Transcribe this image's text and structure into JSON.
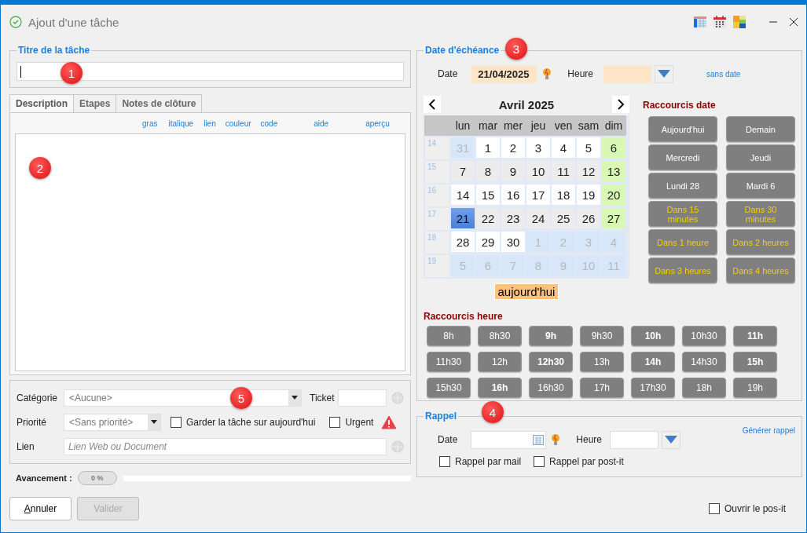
{
  "window": {
    "title": "Ajout d'une tâche"
  },
  "title_section": {
    "legend": "Titre de la tâche"
  },
  "tabs": [
    {
      "label": "Description",
      "selected": true
    },
    {
      "label": "Etapes",
      "selected": false
    },
    {
      "label": "Notes de clôture",
      "selected": false
    }
  ],
  "editor_toolbar": [
    "gras",
    "italique",
    "lien",
    "couleur",
    "code",
    "aide",
    "aperçu"
  ],
  "properties": {
    "category": {
      "label": "Catégorie",
      "value": "<Aucune>"
    },
    "ticket": {
      "label": "Ticket"
    },
    "priority": {
      "label": "Priorité",
      "value": "<Sans priorité>"
    },
    "keep_today": {
      "label": "Garder la tâche sur aujourd'hui",
      "checked": false
    },
    "urgent": {
      "label": "Urgent",
      "checked": false
    },
    "link": {
      "label": "Lien",
      "placeholder": "Lien Web ou Document"
    }
  },
  "progress": {
    "label": "Avancement :",
    "reading": "0 %",
    "level": 0
  },
  "due": {
    "legend": "Date d'échéance",
    "date_label": "Date",
    "date_value": "21/04/2025",
    "time_label": "Heure",
    "no_date_link": "sans date"
  },
  "calendar": {
    "month": "Avril 2025",
    "weekdays": [
      "lun",
      "mar",
      "mer",
      "jeu",
      "ven",
      "sam",
      "dim"
    ],
    "weeks": [
      {
        "number": "14",
        "days": [
          {
            "day": "31",
            "kind": "other",
            "selected": false
          },
          {
            "day": "1",
            "kind": "normal",
            "selected": false
          },
          {
            "day": "2",
            "kind": "normal",
            "selected": false
          },
          {
            "day": "3",
            "kind": "normal",
            "selected": false
          },
          {
            "day": "4",
            "kind": "normal",
            "selected": false
          },
          {
            "day": "5",
            "kind": "normal",
            "selected": false
          },
          {
            "day": "6",
            "kind": "sunday",
            "selected": false
          }
        ]
      },
      {
        "number": "15",
        "days": [
          {
            "day": "7",
            "kind": "normal",
            "selected": false
          },
          {
            "day": "8",
            "kind": "normal",
            "selected": false
          },
          {
            "day": "9",
            "kind": "normal",
            "selected": false
          },
          {
            "day": "10",
            "kind": "normal",
            "selected": false
          },
          {
            "day": "11",
            "kind": "normal",
            "selected": false
          },
          {
            "day": "12",
            "kind": "normal",
            "selected": false
          },
          {
            "day": "13",
            "kind": "sunday",
            "selected": false
          }
        ]
      },
      {
        "number": "16",
        "days": [
          {
            "day": "14",
            "kind": "normal",
            "selected": false
          },
          {
            "day": "15",
            "kind": "normal",
            "selected": false
          },
          {
            "day": "16",
            "kind": "normal",
            "selected": false
          },
          {
            "day": "17",
            "kind": "normal",
            "selected": false
          },
          {
            "day": "18",
            "kind": "normal",
            "selected": false
          },
          {
            "day": "19",
            "kind": "normal",
            "selected": false
          },
          {
            "day": "20",
            "kind": "sunday",
            "selected": false
          }
        ]
      },
      {
        "number": "17",
        "days": [
          {
            "day": "21",
            "kind": "normal",
            "selected": true
          },
          {
            "day": "22",
            "kind": "normal",
            "selected": false
          },
          {
            "day": "23",
            "kind": "normal",
            "selected": false
          },
          {
            "day": "24",
            "kind": "normal",
            "selected": false
          },
          {
            "day": "25",
            "kind": "normal",
            "selected": false
          },
          {
            "day": "26",
            "kind": "normal",
            "selected": false
          },
          {
            "day": "27",
            "kind": "sunday",
            "selected": false
          }
        ]
      },
      {
        "number": "18",
        "days": [
          {
            "day": "28",
            "kind": "normal",
            "selected": false
          },
          {
            "day": "29",
            "kind": "normal",
            "selected": false
          },
          {
            "day": "30",
            "kind": "normal",
            "selected": false
          },
          {
            "day": "1",
            "kind": "other",
            "selected": false
          },
          {
            "day": "2",
            "kind": "other",
            "selected": false
          },
          {
            "day": "3",
            "kind": "other",
            "selected": false
          },
          {
            "day": "4",
            "kind": "other",
            "selected": false
          }
        ]
      },
      {
        "number": "19",
        "days": [
          {
            "day": "5",
            "kind": "other",
            "selected": false
          },
          {
            "day": "6",
            "kind": "other",
            "selected": false
          },
          {
            "day": "7",
            "kind": "other",
            "selected": false
          },
          {
            "day": "8",
            "kind": "other",
            "selected": false
          },
          {
            "day": "9",
            "kind": "other",
            "selected": false
          },
          {
            "day": "10",
            "kind": "other",
            "selected": false
          },
          {
            "day": "11",
            "kind": "other",
            "selected": false
          }
        ]
      }
    ],
    "today_button": "aujourd'hui"
  },
  "date_shortcuts": {
    "title": "Raccourcis date",
    "buttons": [
      {
        "label": "Aujourd'hui",
        "kind": "day"
      },
      {
        "label": "Demain",
        "kind": "day"
      },
      {
        "label": "Mercredi",
        "kind": "day"
      },
      {
        "label": "Jeudi",
        "kind": "day"
      },
      {
        "label": "Lundi 28",
        "kind": "day"
      },
      {
        "label": "Mardi 6",
        "kind": "day"
      },
      {
        "label": "Dans 15 minutes",
        "kind": "delay"
      },
      {
        "label": "Dans 30 minutes",
        "kind": "delay"
      },
      {
        "label": "Dans 1 heure",
        "kind": "delay"
      },
      {
        "label": "Dans 2 heures",
        "kind": "delay"
      },
      {
        "label": "Dans 3 heures",
        "kind": "delay"
      },
      {
        "label": "Dans 4 heures",
        "kind": "delay"
      }
    ]
  },
  "time_shortcuts": {
    "title": "Raccourcis heure",
    "buttons": [
      {
        "label": "8h",
        "emphasized": false
      },
      {
        "label": "8h30",
        "emphasized": false
      },
      {
        "label": "9h",
        "emphasized": true
      },
      {
        "label": "9h30",
        "emphasized": false
      },
      {
        "label": "10h",
        "emphasized": true
      },
      {
        "label": "10h30",
        "emphasized": false
      },
      {
        "label": "11h",
        "emphasized": true
      },
      {
        "label": "11h30",
        "emphasized": false
      },
      {
        "label": "12h",
        "emphasized": false
      },
      {
        "label": "12h30",
        "emphasized": true
      },
      {
        "label": "13h",
        "emphasized": false
      },
      {
        "label": "14h",
        "emphasized": true
      },
      {
        "label": "14h30",
        "emphasized": false
      },
      {
        "label": "15h",
        "emphasized": true
      },
      {
        "label": "15h30",
        "emphasized": false
      },
      {
        "label": "16h",
        "emphasized": true
      },
      {
        "label": "16h30",
        "emphasized": false
      },
      {
        "label": "17h",
        "emphasized": false
      },
      {
        "label": "17h30",
        "emphasized": false
      },
      {
        "label": "18h",
        "emphasized": false
      },
      {
        "label": "19h",
        "emphasized": false
      }
    ]
  },
  "reminder": {
    "legend": "Rappel",
    "date_label": "Date",
    "time_label": "Heure",
    "generate_link": "Générer rappel",
    "options": [
      {
        "label": "Rappel par mail",
        "checked": false
      },
      {
        "label": "Rappel par post-it",
        "checked": false
      }
    ]
  },
  "footer": {
    "cancel": "Annuler",
    "validate": {
      "label": "Valider",
      "disabled": true
    },
    "open_postit": {
      "label": "Ouvrir le pos-it",
      "checked": false
    }
  },
  "callouts": [
    "1",
    "2",
    "3",
    "4",
    "5"
  ]
}
